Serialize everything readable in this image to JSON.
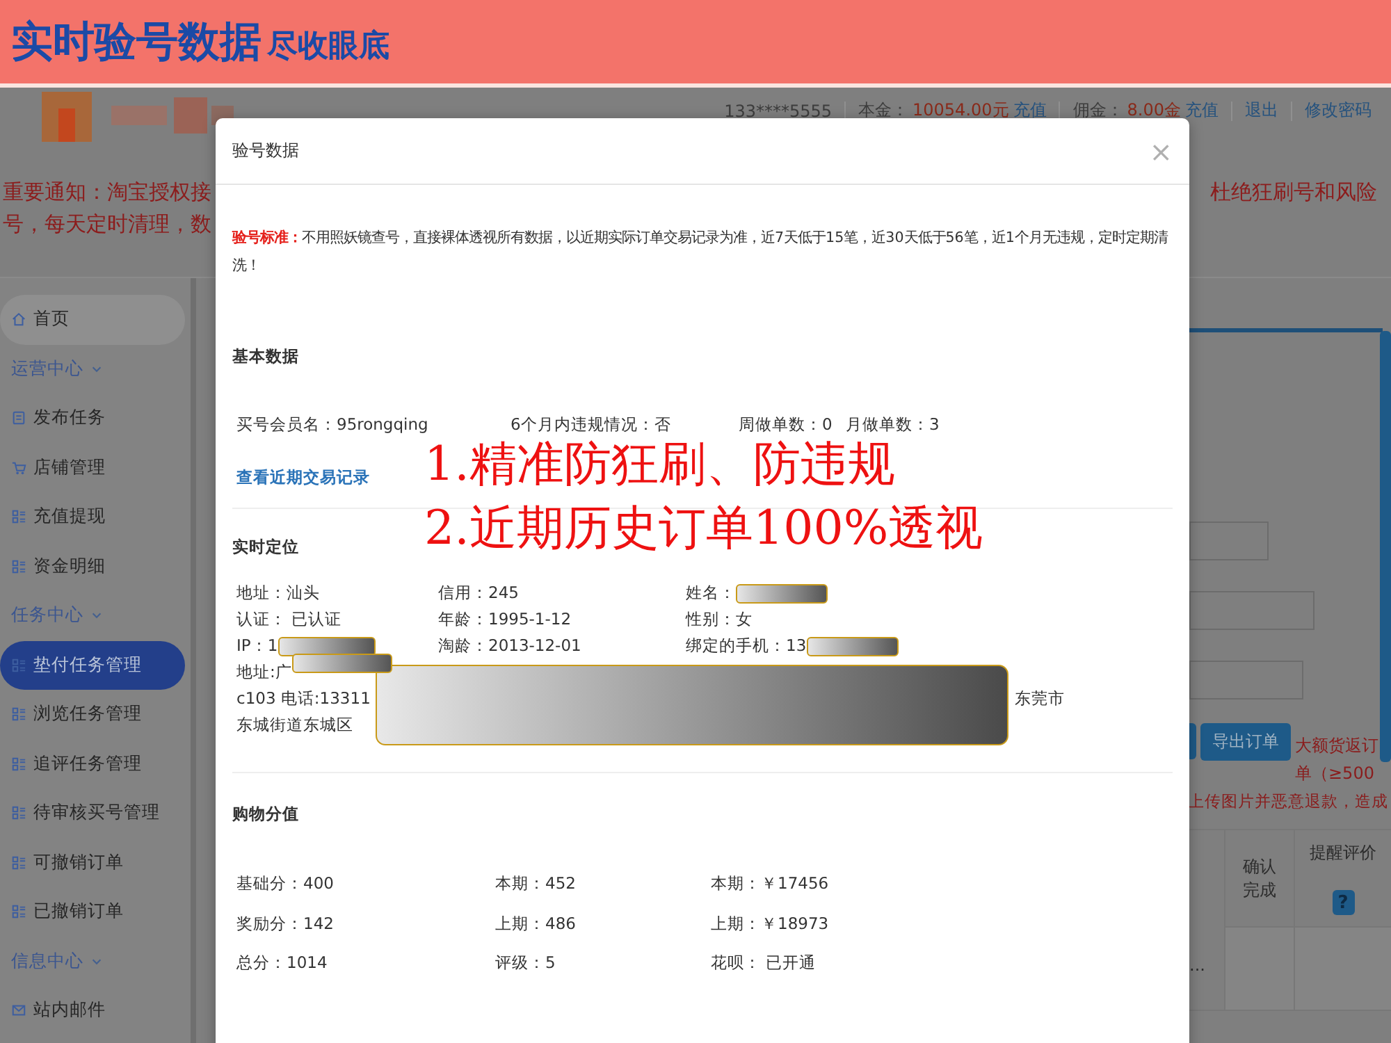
{
  "banner": {
    "title": "实时验号数据",
    "subtitle": "尽收眼底"
  },
  "header": {
    "account": "133****5555",
    "items": [
      {
        "label": "本金：",
        "value": "10054.00元",
        "link": "充值"
      },
      {
        "label": "佣金：",
        "value": "8.00金",
        "link": "充值"
      }
    ],
    "links": [
      "退出",
      "修改密码"
    ]
  },
  "notice": {
    "lines": [
      "重要通知：淘宝授权接",
      "号，每天定时清理，数"
    ],
    "right": "杜绝狂刷号和风险"
  },
  "sidebar": {
    "items": [
      {
        "label": "首页",
        "kind": "home",
        "selected": false
      },
      {
        "label": "运营中心",
        "kind": "group",
        "expanded": true
      },
      {
        "label": "发布任务",
        "kind": "publish",
        "selected": false
      },
      {
        "label": "店铺管理",
        "kind": "shop",
        "selected": false
      },
      {
        "label": "充值提现",
        "kind": "item",
        "selected": false
      },
      {
        "label": "资金明细",
        "kind": "item",
        "selected": false
      },
      {
        "label": "任务中心",
        "kind": "group",
        "expanded": true
      },
      {
        "label": "垫付任务管理",
        "kind": "item",
        "selected": true
      },
      {
        "label": "浏览任务管理",
        "kind": "item",
        "selected": false
      },
      {
        "label": "追评任务管理",
        "kind": "item",
        "selected": false
      },
      {
        "label": "待审核买号管理",
        "kind": "item",
        "selected": false
      },
      {
        "label": "可撤销订单",
        "kind": "item",
        "selected": false
      },
      {
        "label": "已撤销订单",
        "kind": "item",
        "selected": false
      },
      {
        "label": "信息中心",
        "kind": "group",
        "expanded": true
      },
      {
        "label": "站内邮件",
        "kind": "mail",
        "selected": false
      }
    ]
  },
  "main": {
    "export_button": "导出订单",
    "warning_lines": [
      "大额货返订",
      "单（≥500",
      "上传图片并恶意退款，造成"
    ],
    "table": {
      "columns": [
        "确认完成",
        "提醒评价"
      ],
      "help": "?",
      "row_cell": "..."
    }
  },
  "modal": {
    "title": "验号数据",
    "close": "×",
    "standard": {
      "label": "验号标准：",
      "text": "不用照妖镜查号，直接裸体透视所有数据，以近期实际订单交易记录为准，近7天低于15笔，近30天低于56笔，近1个月无违规，定时定期清洗！"
    },
    "basic": {
      "title": "基本数据",
      "fields": [
        "买号会员名：95rongqing",
        "6个月内违规情况：否",
        "周做单数：0",
        "月做单数：3"
      ],
      "link": "查看近期交易记录"
    },
    "location": {
      "title": "实时定位",
      "rows": [
        [
          {
            "text": "地址：汕头"
          },
          {
            "text": "信用：245"
          },
          {
            "text": "姓名：",
            "redacted": true
          }
        ],
        [
          {
            "text": "认证：  已认证"
          },
          {
            "text": "年龄：1995-1-12"
          },
          {
            "text": "性别：女"
          }
        ],
        [
          {
            "text": "IP：1",
            "redacted": true
          },
          {
            "text": "淘龄：2013-12-01"
          },
          {
            "text": "绑定的手机：13",
            "redacted": true
          }
        ]
      ],
      "address_lines": [
        {
          "left": "地址:广",
          "redacted": true
        },
        {
          "left": "c103 电话:13311",
          "right": "东莞市"
        },
        {
          "left": "东城街道东城区"
        }
      ]
    },
    "shopping": {
      "title": "购物分值",
      "rows": [
        [
          "基础分：400",
          "本期：452",
          "本期：￥17456"
        ],
        [
          "奖励分：142",
          "上期：486",
          "上期：￥18973"
        ],
        [
          "总分：1014",
          "评级：5",
          "花呗：  已开通"
        ]
      ]
    }
  },
  "promo": [
    "1.精准防狂刷、防违规",
    "2.近期历史订单100%透视"
  ]
}
